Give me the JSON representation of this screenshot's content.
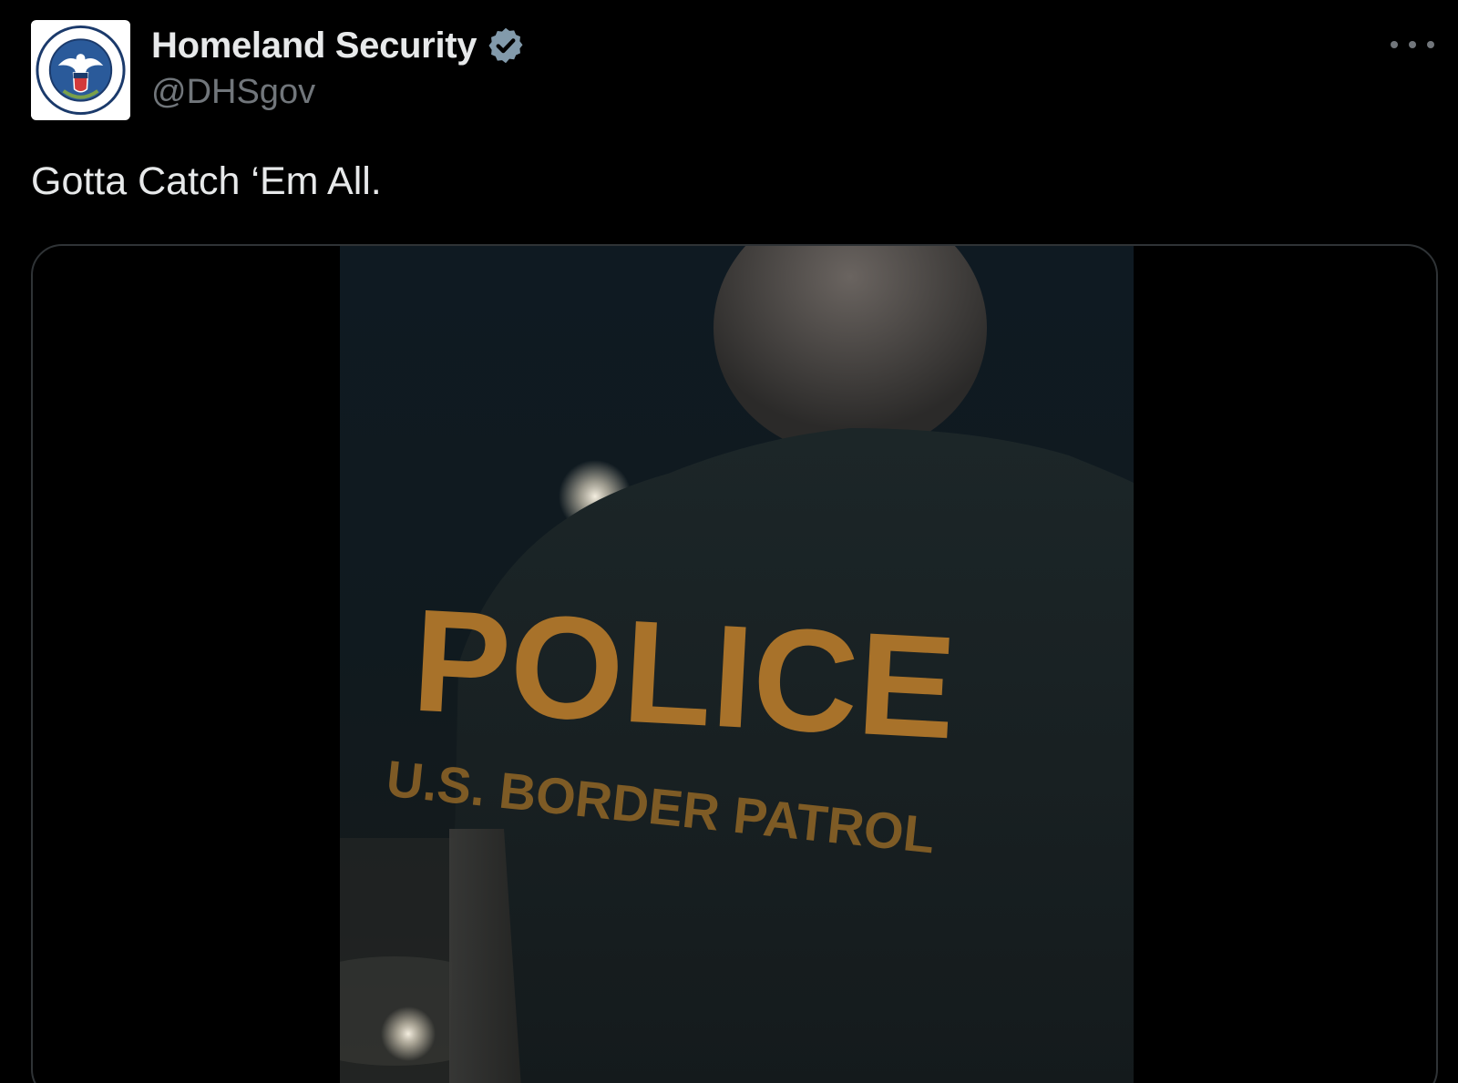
{
  "tweet": {
    "author": {
      "display_name": "Homeland Security",
      "handle": "@DHSgov",
      "verified": true,
      "avatar_icon": "dhs-seal-icon"
    },
    "text": "Gotta Catch ‘Em All.",
    "menu_icon": "more-options-icon",
    "media": {
      "type": "video",
      "jacket_text_large": "POLICE",
      "jacket_text_small": "U.S. BORDER PATROL"
    }
  },
  "colors": {
    "background": "#000000",
    "primary_text": "#e7e9ea",
    "secondary_text": "#71767b",
    "verified_badge": "#829aab",
    "card_border": "#2f3336",
    "jacket_lettering": "#a8722a"
  }
}
